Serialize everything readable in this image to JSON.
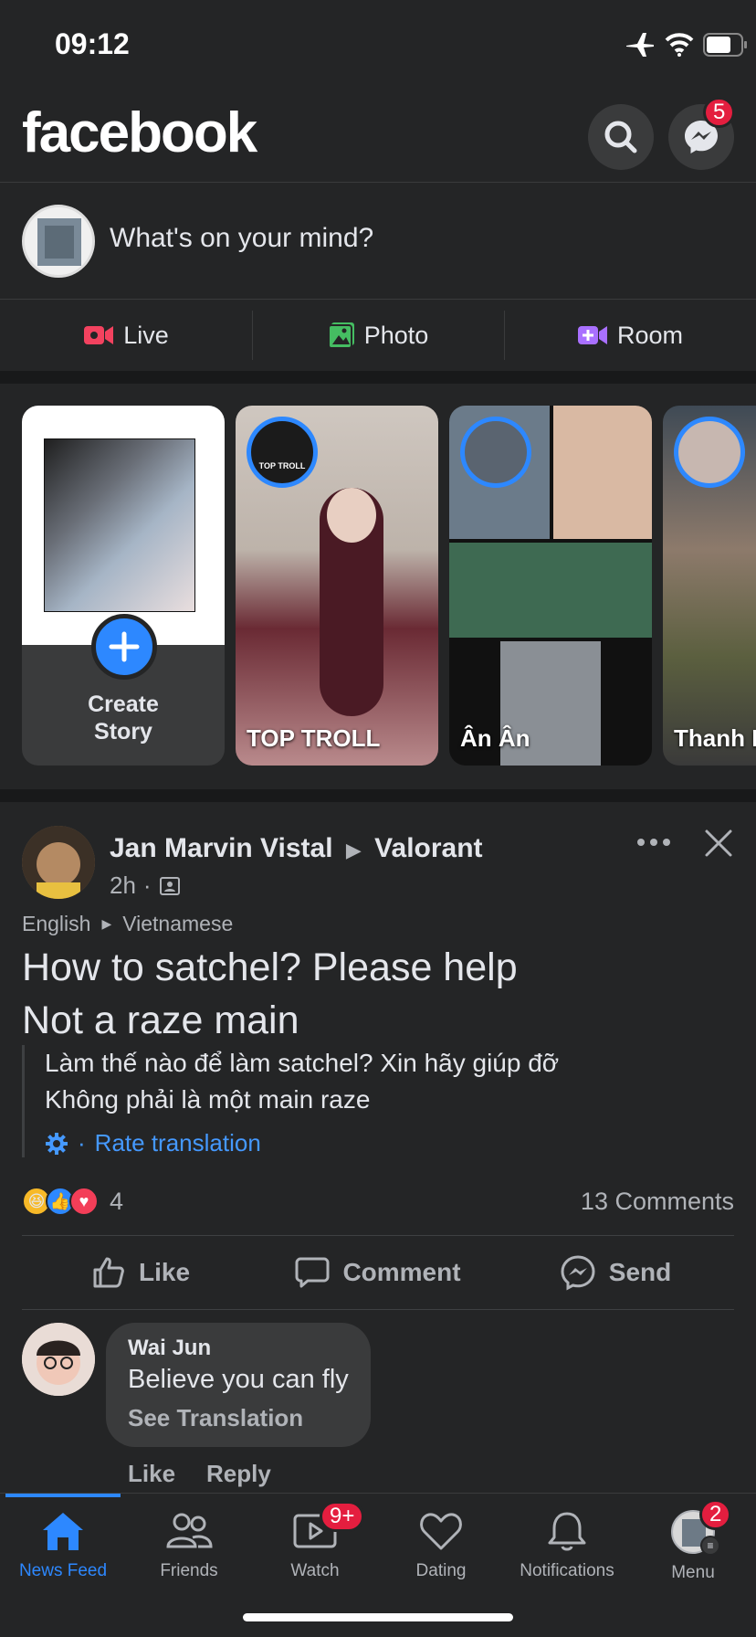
{
  "status": {
    "time": "09:12"
  },
  "header": {
    "logo": "facebook",
    "messenger_badge": "5"
  },
  "composer": {
    "placeholder": "What's on your mind?"
  },
  "quick_actions": [
    {
      "label": "Live",
      "color": "#f3425f"
    },
    {
      "label": "Photo",
      "color": "#45bd62"
    },
    {
      "label": "Room",
      "color": "#a970ff"
    }
  ],
  "stories": {
    "create_label_line1": "Create",
    "create_label_line2": "Story",
    "items": [
      {
        "name": "TOP TROLL",
        "ring_text": "TOP TROLL"
      },
      {
        "name": "Ân Ân"
      },
      {
        "name": "Thanh H"
      }
    ]
  },
  "post": {
    "author": "Jan Marvin Vistal",
    "group": "Valorant",
    "time": "2h",
    "lang_from": "English",
    "lang_to": "Vietnamese",
    "text_line1": "How to satchel? Please help",
    "text_line2": "Not a raze main",
    "translation_line1": "Làm thế nào để làm satchel? Xin hãy giúp đỡ",
    "translation_line2": "Không phải là một main raze",
    "rate_translation": "Rate translation",
    "reaction_count": "4",
    "comments_count": "13 Comments",
    "actions": {
      "like": "Like",
      "comment": "Comment",
      "send": "Send"
    }
  },
  "comment": {
    "author": "Wai Jun",
    "text": "Believe you can fly",
    "see_translation": "See Translation",
    "like": "Like",
    "reply": "Reply"
  },
  "tabs": [
    {
      "label": "News Feed",
      "active": true
    },
    {
      "label": "Friends"
    },
    {
      "label": "Watch",
      "badge": "9+"
    },
    {
      "label": "Dating"
    },
    {
      "label": "Notifications"
    },
    {
      "label": "Menu",
      "badge": "2"
    }
  ],
  "colors": {
    "accent": "#2d88ff",
    "badge": "#e41e3f",
    "background": "#242526"
  }
}
